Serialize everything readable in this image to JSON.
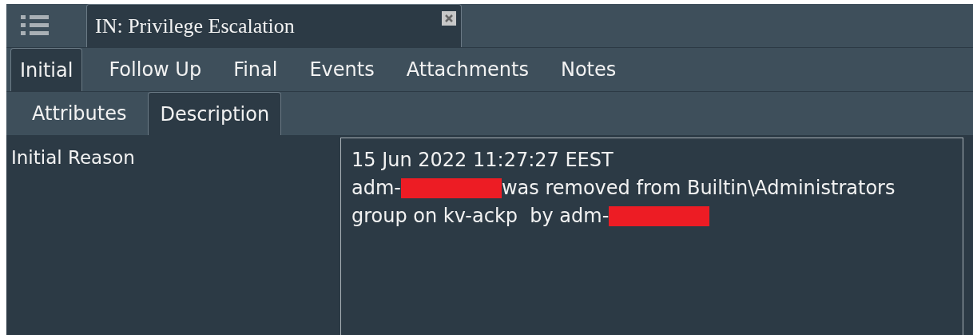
{
  "document_tab": {
    "title": "IN: Privilege Escalation"
  },
  "tabs": [
    {
      "label": "Initial",
      "selected": true
    },
    {
      "label": "Follow Up",
      "selected": false
    },
    {
      "label": "Final",
      "selected": false
    },
    {
      "label": "Events",
      "selected": false
    },
    {
      "label": "Attachments",
      "selected": false
    },
    {
      "label": "Notes",
      "selected": false
    }
  ],
  "subtabs": [
    {
      "label": "Attributes",
      "selected": false
    },
    {
      "label": "Description",
      "selected": true
    }
  ],
  "field": {
    "label": "Initial Reason",
    "lines": [
      [
        {
          "kind": "text",
          "text": "15 Jun 2022 11:27:27 EEST"
        }
      ],
      [
        {
          "kind": "text",
          "text": "adm-"
        },
        {
          "kind": "redaction"
        },
        {
          "kind": "text",
          "text": "was removed from Builtin\\Administrators"
        }
      ],
      [
        {
          "kind": "text",
          "text": "group on kv-ackp  by adm-"
        },
        {
          "kind": "redaction"
        }
      ]
    ]
  }
}
